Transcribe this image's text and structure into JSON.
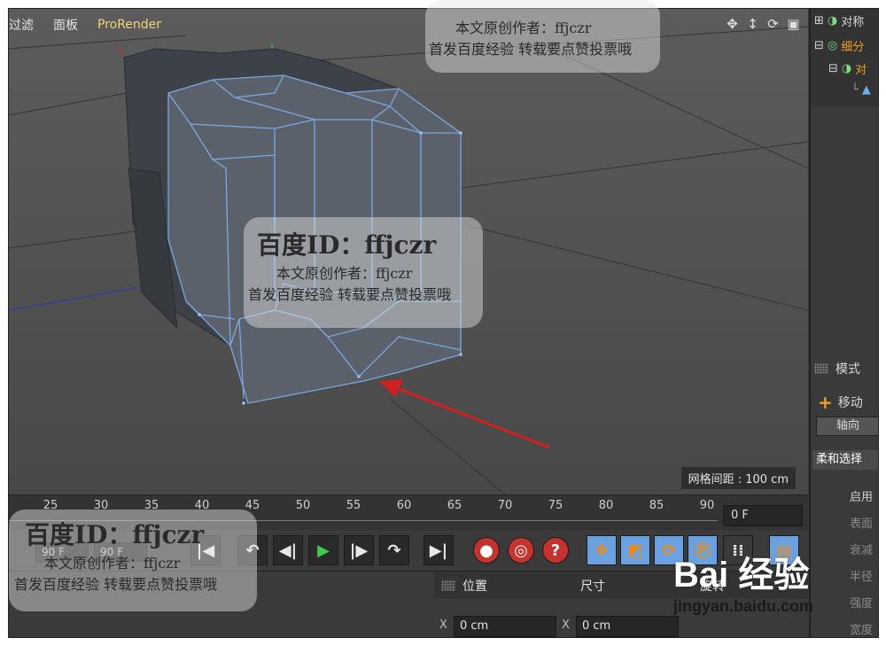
{
  "viewport": {
    "menu": [
      "过滤",
      "面板",
      "ProRender"
    ],
    "nav_icons": [
      "move-view-icon",
      "zoom-view-icon",
      "rotate-view-icon",
      "maximize-view-icon"
    ],
    "grid_spacing": "网格间距 : 100 cm"
  },
  "object_manager": {
    "items": [
      {
        "label": "对称",
        "color": "#e6e6e6"
      },
      {
        "label": "细分",
        "color": "#f0a020"
      },
      {
        "label": "对",
        "color": "#f0a020"
      }
    ]
  },
  "timeline": {
    "ticks": [
      "25",
      "30",
      "35",
      "40",
      "45",
      "50",
      "55",
      "60",
      "65",
      "70",
      "75",
      "80",
      "85",
      "90"
    ],
    "current_frame": "0 F"
  },
  "transport": {
    "start_frame": "90 F",
    "end_frame": "90 F"
  },
  "attributes": {
    "title": "模式",
    "tool": "移动",
    "tab": "轴向",
    "section": "柔和选择",
    "props": [
      "启用",
      "表面",
      "衰减",
      "半径",
      "强度",
      "宽度"
    ]
  },
  "coordinates": {
    "position_header": "位置",
    "size_header": "尺寸",
    "rotation_header": "旋转",
    "x_label": "X",
    "position_x": "0 cm",
    "size_x": "0 cm"
  },
  "watermarks": {
    "line1": "百度ID：ffjczr",
    "line2": "本文原创作者：ffjczr",
    "line3": "首发百度经验 转载要点赞投票哦"
  },
  "baidu": {
    "logo": "Bai 经验",
    "url": "jingyan.baidu.com"
  }
}
